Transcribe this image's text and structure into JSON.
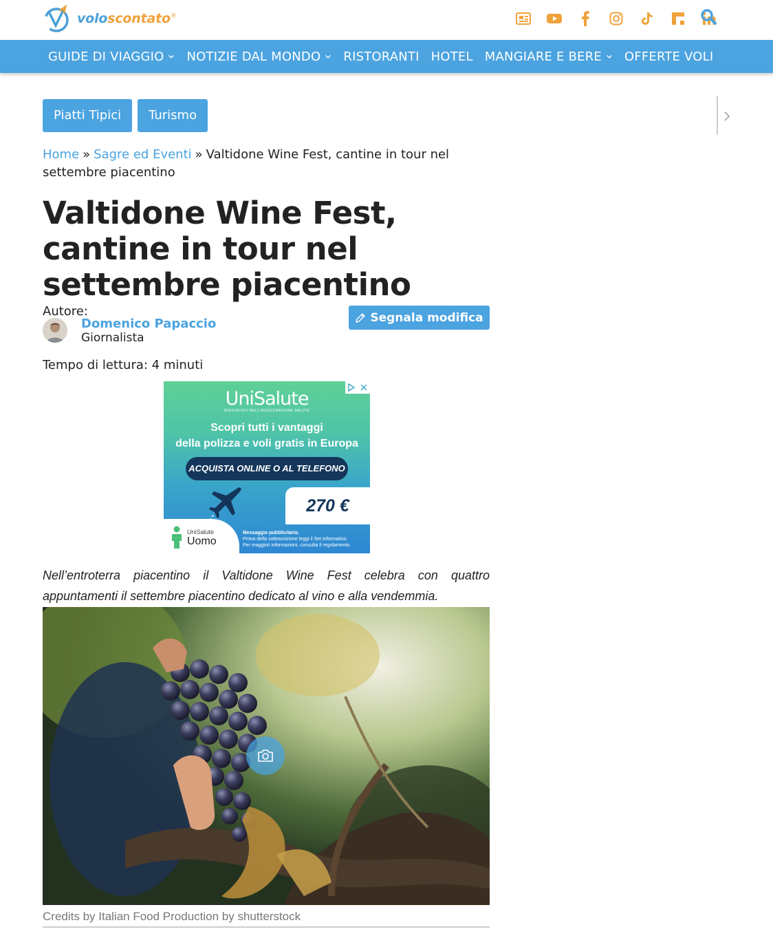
{
  "header": {
    "logo_part1": "volo",
    "logo_part2": "scontato",
    "logo_mark": "®",
    "social_icons": [
      "newspaper-icon",
      "youtube-icon",
      "facebook-icon",
      "instagram-icon",
      "tiktok-icon",
      "flipboard-icon",
      "linkedin-icon"
    ],
    "search_icon": "search-icon",
    "brand_colors": {
      "blue": "#4ba3e0",
      "orange": "#f0a23b"
    }
  },
  "nav": {
    "items": [
      {
        "label": "GUIDE DI VIAGGIO",
        "has_dropdown": true
      },
      {
        "label": "NOTIZIE DAL MONDO",
        "has_dropdown": true
      },
      {
        "label": "RISTORANTI",
        "has_dropdown": false
      },
      {
        "label": "HOTEL",
        "has_dropdown": false
      },
      {
        "label": "MANGIARE E BERE",
        "has_dropdown": true
      },
      {
        "label": "OFFERTE VOLI",
        "has_dropdown": false
      }
    ]
  },
  "tags": [
    "Piatti Tipici",
    "Turismo"
  ],
  "breadcrumb": {
    "home": "Home",
    "section": "Sagre ed Eventi",
    "separator": "»",
    "current": "Valtidone Wine Fest, cantine in tour nel settembre piacentino"
  },
  "article": {
    "title": "Valtidone Wine Fest, cantine in tour nel settembre piacentino",
    "author_label": "Autore:",
    "author_name": "Domenico Papaccio",
    "author_role": "Giornalista",
    "edit_label": "Segnala modifica",
    "reading_time": "Tempo di lettura: 4 minuti",
    "lead": "Nell’entroterra piacentino il Valtidone Wine Fest celebra con quattro appuntamenti il settembre piacentino dedicato al vino e alla vendemmia.",
    "image_credits": "Credits by Italian Food Production by shutterstock"
  },
  "ad": {
    "brand": "UniSalute",
    "brand_sub": "SPECIALISTI NELL'ASSICURAZIONE SALUTE",
    "headline_line1": "Scopri tutti i vantaggi",
    "headline_line2": "della polizza e voli gratis in Europa",
    "cta": "ACQUISTA ONLINE O AL TELEFONO",
    "price": "270 €",
    "product_small": "UniSalute",
    "product": "Uomo",
    "fine_title": "Messaggio pubblicitario.",
    "fine_line1": "Prima della sottoscrizione leggi il Set Informativo.",
    "fine_line2": "Per maggiori informazioni, consulta il regolamento."
  }
}
